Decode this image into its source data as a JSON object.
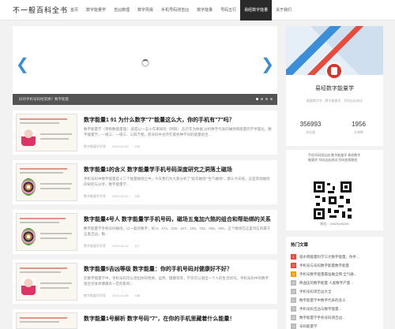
{
  "site": {
    "logo": "不一般百科全书"
  },
  "nav": [
    {
      "label": "首页"
    },
    {
      "label": "数字能量学"
    },
    {
      "label": "吉凶数理"
    },
    {
      "label": "数字周易"
    },
    {
      "label": "手机号码测吉凶"
    },
    {
      "label": "数字能量"
    },
    {
      "label": "号码五行"
    },
    {
      "label": "易经数字能量"
    },
    {
      "label": "关于我们"
    }
  ],
  "slider": {
    "caption": "旧的手机号码经常换？数字能量",
    "prev_icon": "chevron-left-icon",
    "next_icon": "chevron-right-icon",
    "active_dot": 0
  },
  "posts": [
    {
      "title": "数字能量1 91 为什么数字\"7\"能量这么大，你的手机有\"7\"吗？",
      "excerpt": "数字能量学（简称数能量理）,就是以一五十年来研究（阴阳）,五行年为依据,分析数字代表的磁场和能量的学术理论。数字能量学，一组三、一组三、三四万物，而号码中也存在着各种不同的能量组合...",
      "meta": [
        "数字能量学学家",
        "2019-10-23",
        "159"
      ]
    },
    {
      "title": "数字能量1的含义 数字能量学手机号码深度研究之洞落土磁场",
      "excerpt": "手机号码中数字能量是十二个能量磁场之中，今天我们为大家分析了“延年磁场”“生气磁场”，那么今天呢，这是其他磁场的研究与分享，数字能量学...",
      "meta": [
        "数字能量学学家",
        "2019-10-21",
        "232"
      ]
    },
    {
      "title": "数字能量4号人 数字能量学手机号码，磁场五鬼加六煞的组合和帮助绑的关系",
      "excerpt": "数字能量学手机号码磁场，以一般的数字，如 8、474、318、247、105、762、836、925，五个磁场在这里对应的属于五鬼吉凶，数...",
      "meta": [
        "数字能量学学家",
        "2019-10-12",
        "117"
      ]
    },
    {
      "title": "数字能量5吉凶等级 数字能量：你的手机号码对健康好不好？",
      "excerpt": "在数字能量学中，手机号码可以测出你的性格、运势、健康等等，不仅可以测出一个人的生活状况，手机号码中的数字组合对身体健康有一定的影响...",
      "meta": [
        "数字能量学学家",
        "2019-10-08",
        "188"
      ]
    },
    {
      "title": "数字能量1号解析 数字号码\"7\"，在你的手机里藏着什么能量！",
      "excerpt": "",
      "meta": []
    }
  ],
  "profile": {
    "name": "易经数字能量学",
    "desc": "能量数字学 - 数字能量学 - 号码吉凶测试",
    "stats": [
      {
        "value": "356993",
        "label": "浏览量"
      },
      {
        "value": "1956",
        "label": "文章数"
      }
    ]
  },
  "qr": {
    "text": "手机号码测吉凶 数字能量学 易经数字能量学 号码吉凶测试 扫码加我微信",
    "footer": "微信：15625048285"
  },
  "hot": {
    "title": "热门文章",
    "items": [
      {
        "label": "吸水网能量科学三大数字能量，你手..."
      },
      {
        "label": "手机号与号码数字能量数字能量"
      },
      {
        "label": "手机号数字能量最准确全网 全气磁..."
      },
      {
        "label": "降血压的数字能量 人类数字产量..."
      },
      {
        "label": "手机号码测吉凶大全"
      },
      {
        "label": "数字能量学中数字代表的含义"
      },
      {
        "label": "手机号码吉凶与数字能量..."
      },
      {
        "label": "数字能量学手机号码测吉凶..."
      },
      {
        "label": "号码能量学"
      }
    ]
  },
  "colors": {
    "nav_active": "#2a2a2a",
    "accent_blue": "#3a8fd8",
    "hot_red": "#e74c3c",
    "hot_orange": "#f39c12"
  }
}
